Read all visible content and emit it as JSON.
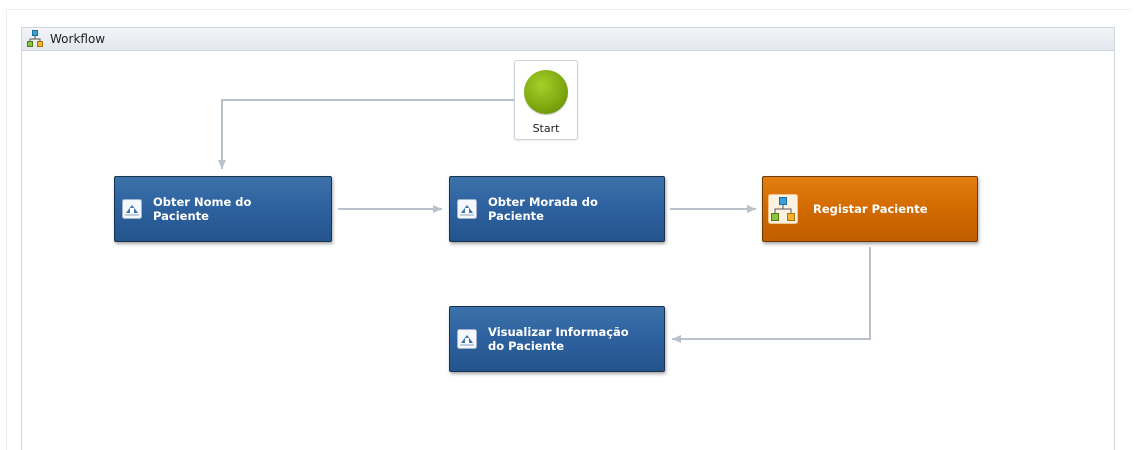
{
  "designer": {
    "title": "Workflow",
    "icon": "workflow-icon"
  },
  "start_node": {
    "label": "Start",
    "color": "#7faa10"
  },
  "activities": [
    {
      "label": "Obter Nome do\nPaciente",
      "icon": "activity-form-icon",
      "color": "#2e62a0"
    },
    {
      "label": "Obter Morada do\nPaciente",
      "icon": "activity-form-icon",
      "color": "#2e62a0"
    },
    {
      "label": "Registar Paciente",
      "icon": "workflow-icon",
      "color": "#d26a00"
    },
    {
      "label": "Visualizar Informação\ndo Paciente",
      "icon": "activity-form-icon",
      "color": "#2e62a0"
    }
  ],
  "colors": {
    "connector": "#b9c2cb",
    "header_bg": "#e3e8ee"
  }
}
